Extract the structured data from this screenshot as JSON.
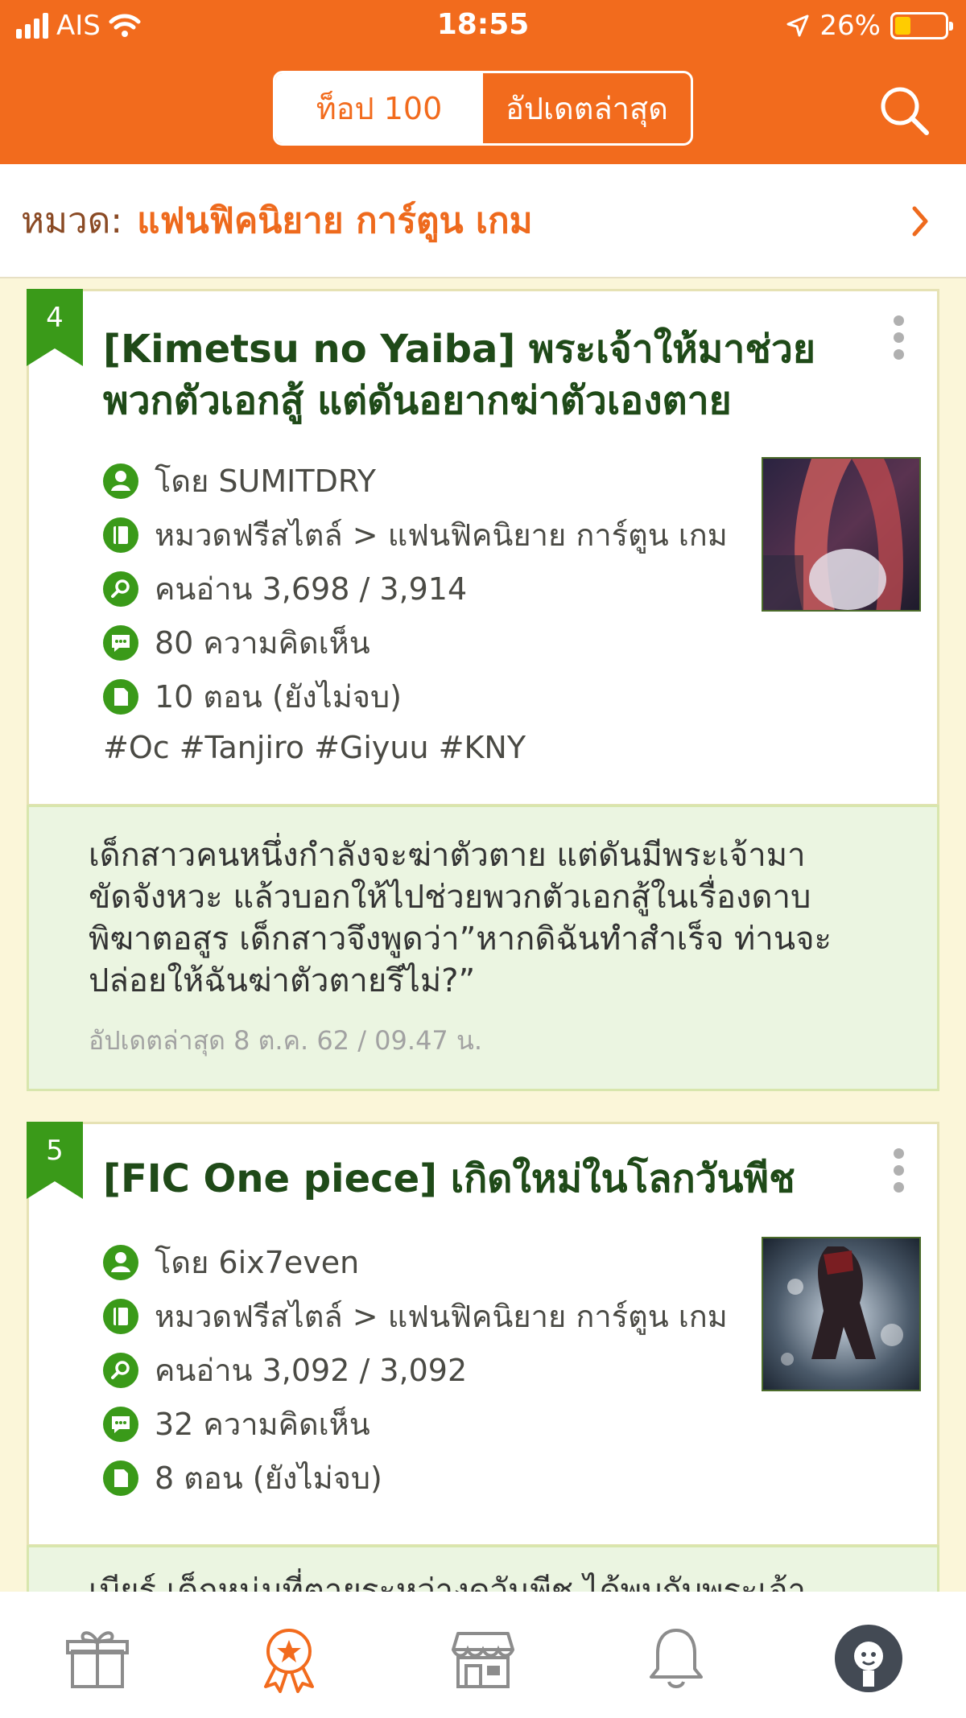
{
  "status": {
    "carrier": "AIS",
    "time": "18:55",
    "battery": "26%",
    "battery_level": 0.26
  },
  "nav": {
    "tab_top": "ท็อป 100",
    "tab_latest": "อัปเดตล่าสุด",
    "active_tab": "tab_top",
    "search_icon": "search-icon"
  },
  "category": {
    "prefix": "หมวด:",
    "name": "แฟนฟิคนิยาย การ์ตูน เกม"
  },
  "stories": [
    {
      "rank": "4",
      "title": "[Kimetsu no Yaiba] พระเจ้าให้มาช่วยพวกตัวเอกสู้ แต่ดันอยากฆ่าตัวเองตาย",
      "author": "โดย SUMITDRY",
      "category": "หมวดฟรีสไตล์ > แฟนฟิคนิยาย การ์ตูน เกม",
      "views": "คนอ่าน 3,698 / 3,914",
      "comments": "80 ความคิดเห็น",
      "episodes": "10 ตอน (ยังไม่จบ)",
      "tags": "#Oc #Tanjiro #Giyuu #KNY",
      "summary": "เด็กสาวคนหนึ่งกำลังจะฆ่าตัวตาย แต่ดันมีพระเจ้ามาขัดจังหวะ แล้วบอกให้ไปช่วยพวกตัวเอกสู้ในเรื่องดาบพิฆาตอสูร เด็กสาวจึงพูดว่า”หากดิฉันทำสำเร็จ ท่านจะปล่อยให้ฉันฆ่าตัวตายรึไม่?”",
      "updated": "อัปเดตล่าสุด 8 ต.ค. 62 / 09.47 น."
    },
    {
      "rank": "5",
      "title": "[FIC One piece] เกิดใหม่ในโลกวันพีช",
      "author": "โดย 6ix7even",
      "category": "หมวดฟรีสไตล์ > แฟนฟิคนิยาย การ์ตูน เกม",
      "views": "คนอ่าน 3,092 / 3,092",
      "comments": "32 ความคิดเห็น",
      "episodes": "8 ตอน (ยังไม่จบ)",
      "summary_partial": "เบียร์ เด็กหนุ่มที่ตายระหว่างดูวันพีช ได้พบกับพระเจ้า"
    }
  ],
  "tabbar": [
    "gift-icon",
    "award-icon",
    "shop-icon",
    "bell-icon",
    "profile-avatar"
  ],
  "colors": {
    "brand": "#f26b1d",
    "title_green": "#1f4a18",
    "icon_green": "#3a9a19",
    "summary_bg": "#ebf5e1",
    "page_bg": "#fbf6d9"
  }
}
